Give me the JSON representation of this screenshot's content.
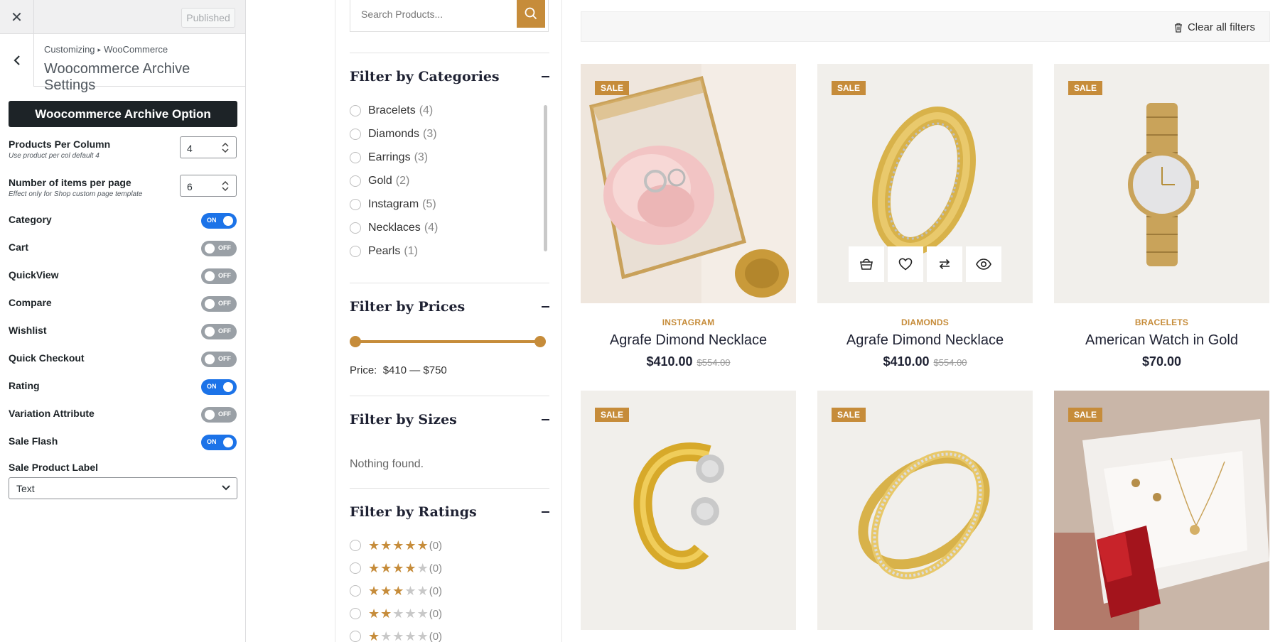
{
  "customizer": {
    "publish_label": "Published",
    "breadcrumb": {
      "root": "Customizing",
      "section": "WooCommerce"
    },
    "title": "Woocommerce Archive Settings",
    "section_button": "Woocommerce Archive Option",
    "products_per_column": {
      "label": "Products Per Column",
      "description": "Use product per col default 4",
      "value": "4"
    },
    "items_per_page": {
      "label": "Number of items per page",
      "description": "Effect only for Shop custom page template",
      "value": "6"
    },
    "toggles": [
      {
        "label": "Category",
        "state": "ON"
      },
      {
        "label": "Cart",
        "state": "OFF"
      },
      {
        "label": "QuickView",
        "state": "OFF"
      },
      {
        "label": "Compare",
        "state": "OFF"
      },
      {
        "label": "Wishlist",
        "state": "OFF"
      },
      {
        "label": "Quick Checkout",
        "state": "OFF"
      },
      {
        "label": "Rating",
        "state": "ON"
      },
      {
        "label": "Variation Attribute",
        "state": "OFF"
      },
      {
        "label": "Sale Flash",
        "state": "ON"
      }
    ],
    "sale_label": {
      "label": "Sale Product Label",
      "value": "Text"
    }
  },
  "shop": {
    "search_placeholder": "Search Products...",
    "filters": {
      "categories_title": "Filter by Categories",
      "categories": [
        {
          "name": "Bracelets",
          "count": "(4)"
        },
        {
          "name": "Diamonds",
          "count": "(3)"
        },
        {
          "name": "Earrings",
          "count": "(3)"
        },
        {
          "name": "Gold",
          "count": "(2)"
        },
        {
          "name": "Instagram",
          "count": "(5)"
        },
        {
          "name": "Necklaces",
          "count": "(4)"
        },
        {
          "name": "Pearls",
          "count": "(1)"
        }
      ],
      "prices_title": "Filter by Prices",
      "price_label": "Price:",
      "price_range": "$410 — $750",
      "sizes_title": "Filter by Sizes",
      "sizes_empty": "Nothing found.",
      "ratings_title": "Filter by Ratings",
      "ratings": [
        {
          "stars": 5,
          "count": "(0)"
        },
        {
          "stars": 4,
          "count": "(0)"
        },
        {
          "stars": 3,
          "count": "(0)"
        },
        {
          "stars": 2,
          "count": "(0)"
        },
        {
          "stars": 1,
          "count": "(0)"
        }
      ]
    },
    "clear_filters": "Clear all filters",
    "sale_badge": "SALE",
    "products": [
      {
        "category": "INSTAGRAM",
        "name": "Agrafe Dimond Necklace",
        "price": "$410.00",
        "old_price": "$554.00",
        "image": "ring-box-image"
      },
      {
        "category": "DIAMONDS",
        "name": "Agrafe Dimond Necklace",
        "price": "$410.00",
        "old_price": "$554.00",
        "image": "gold-ring-image"
      },
      {
        "category": "BRACELETS",
        "name": "American Watch in Gold",
        "price": "$70.00",
        "old_price": "",
        "image": "gold-watch-image"
      },
      {
        "category": "",
        "name": "",
        "price": "",
        "old_price": "",
        "image": "gold-cuff-image"
      },
      {
        "category": "",
        "name": "",
        "price": "",
        "old_price": "",
        "image": "crossover-ring-image"
      },
      {
        "category": "",
        "name": "",
        "price": "",
        "old_price": "",
        "image": "gift-box-image"
      }
    ],
    "quick_actions": [
      "cart-icon",
      "heart-icon",
      "compare-icon",
      "eye-icon"
    ]
  },
  "colors": {
    "accent": "#c68c3a",
    "toggle_on": "#1c73e8",
    "toggle_off": "#9aa0a6",
    "dark": "#1d2327"
  }
}
